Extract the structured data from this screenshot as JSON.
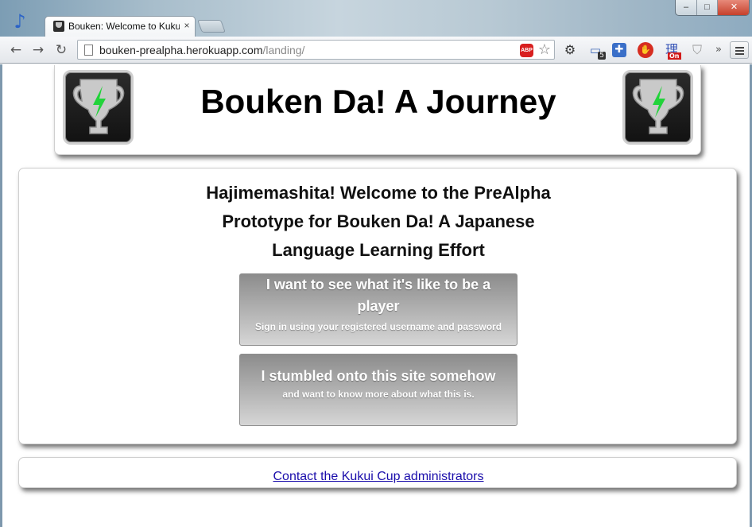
{
  "browser": {
    "tab_title": "Bouken: Welcome to Kuku",
    "tab_close": "×",
    "url_host": "bouken-prealpha.herokuapp.com",
    "url_path": "/landing/",
    "nav": {
      "back": "←",
      "forward": "→",
      "reload": "↻"
    },
    "window": {
      "minimize": "–",
      "maximize": "□",
      "close": "✕"
    },
    "extensions": {
      "abp": "ABP",
      "star": "☆",
      "gear": "⚙",
      "badge_count": "5",
      "kanji": "理",
      "kanji_badge": "On",
      "overflow": "»"
    }
  },
  "header": {
    "title": "Bouken Da! A Journey"
  },
  "main": {
    "welcome": "Hajimemashita! Welcome to the PreAlpha Prototype for Bouken Da! A Japanese Language Learning Effort",
    "player_button": {
      "title": "I want to see what it's like to be a player",
      "subtitle": "Sign in using your registered username and password"
    },
    "stumbled_button": {
      "title": "I stumbled onto this site somehow",
      "subtitle": "and want to know more about what this is."
    }
  },
  "footer": {
    "contact_link": "Contact the Kukui Cup administrators"
  },
  "colors": {
    "link": "#1a0dab",
    "button_top": "#8c8c8c",
    "button_bottom": "#d6d6d6",
    "trophy_bolt": "#22d33a"
  },
  "icons": [
    "music-note-icon",
    "page-icon",
    "abp-icon",
    "star-icon",
    "gear-icon",
    "window-badge-icon",
    "puzzle-icon",
    "stop-icon",
    "kanji-icon",
    "shield-icon",
    "chevron-double-right-icon",
    "menu-icon",
    "trophy-icon"
  ]
}
